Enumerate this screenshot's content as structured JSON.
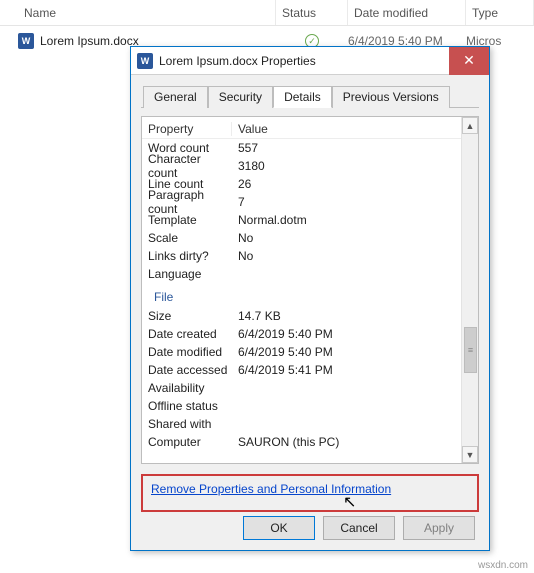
{
  "explorer": {
    "columns": {
      "name": "Name",
      "status": "Status",
      "date": "Date modified",
      "type": "Type"
    },
    "file": {
      "name": "Lorem Ipsum.docx",
      "date": "6/4/2019 5:40 PM",
      "type": "Micros"
    }
  },
  "dialog": {
    "title": "Lorem Ipsum.docx Properties",
    "tabs": {
      "general": "General",
      "security": "Security",
      "details": "Details",
      "previous": "Previous Versions"
    },
    "columns": {
      "property": "Property",
      "value": "Value"
    },
    "props": [
      {
        "name": "Word count",
        "value": "557"
      },
      {
        "name": "Character count",
        "value": "3180"
      },
      {
        "name": "Line count",
        "value": "26"
      },
      {
        "name": "Paragraph count",
        "value": "7"
      },
      {
        "name": "Template",
        "value": "Normal.dotm"
      },
      {
        "name": "Scale",
        "value": "No"
      },
      {
        "name": "Links dirty?",
        "value": "No"
      },
      {
        "name": "Language",
        "value": ""
      }
    ],
    "group_file": "File",
    "file_props": [
      {
        "name": "Size",
        "value": "14.7 KB"
      },
      {
        "name": "Date created",
        "value": "6/4/2019 5:40 PM"
      },
      {
        "name": "Date modified",
        "value": "6/4/2019 5:40 PM"
      },
      {
        "name": "Date accessed",
        "value": "6/4/2019 5:41 PM"
      },
      {
        "name": "Availability",
        "value": ""
      },
      {
        "name": "Offline status",
        "value": ""
      },
      {
        "name": "Shared with",
        "value": ""
      },
      {
        "name": "Computer",
        "value": "SAURON (this PC)"
      }
    ],
    "link": "Remove Properties and Personal Information",
    "buttons": {
      "ok": "OK",
      "cancel": "Cancel",
      "apply": "Apply"
    }
  },
  "watermark": "wsxdn.com"
}
